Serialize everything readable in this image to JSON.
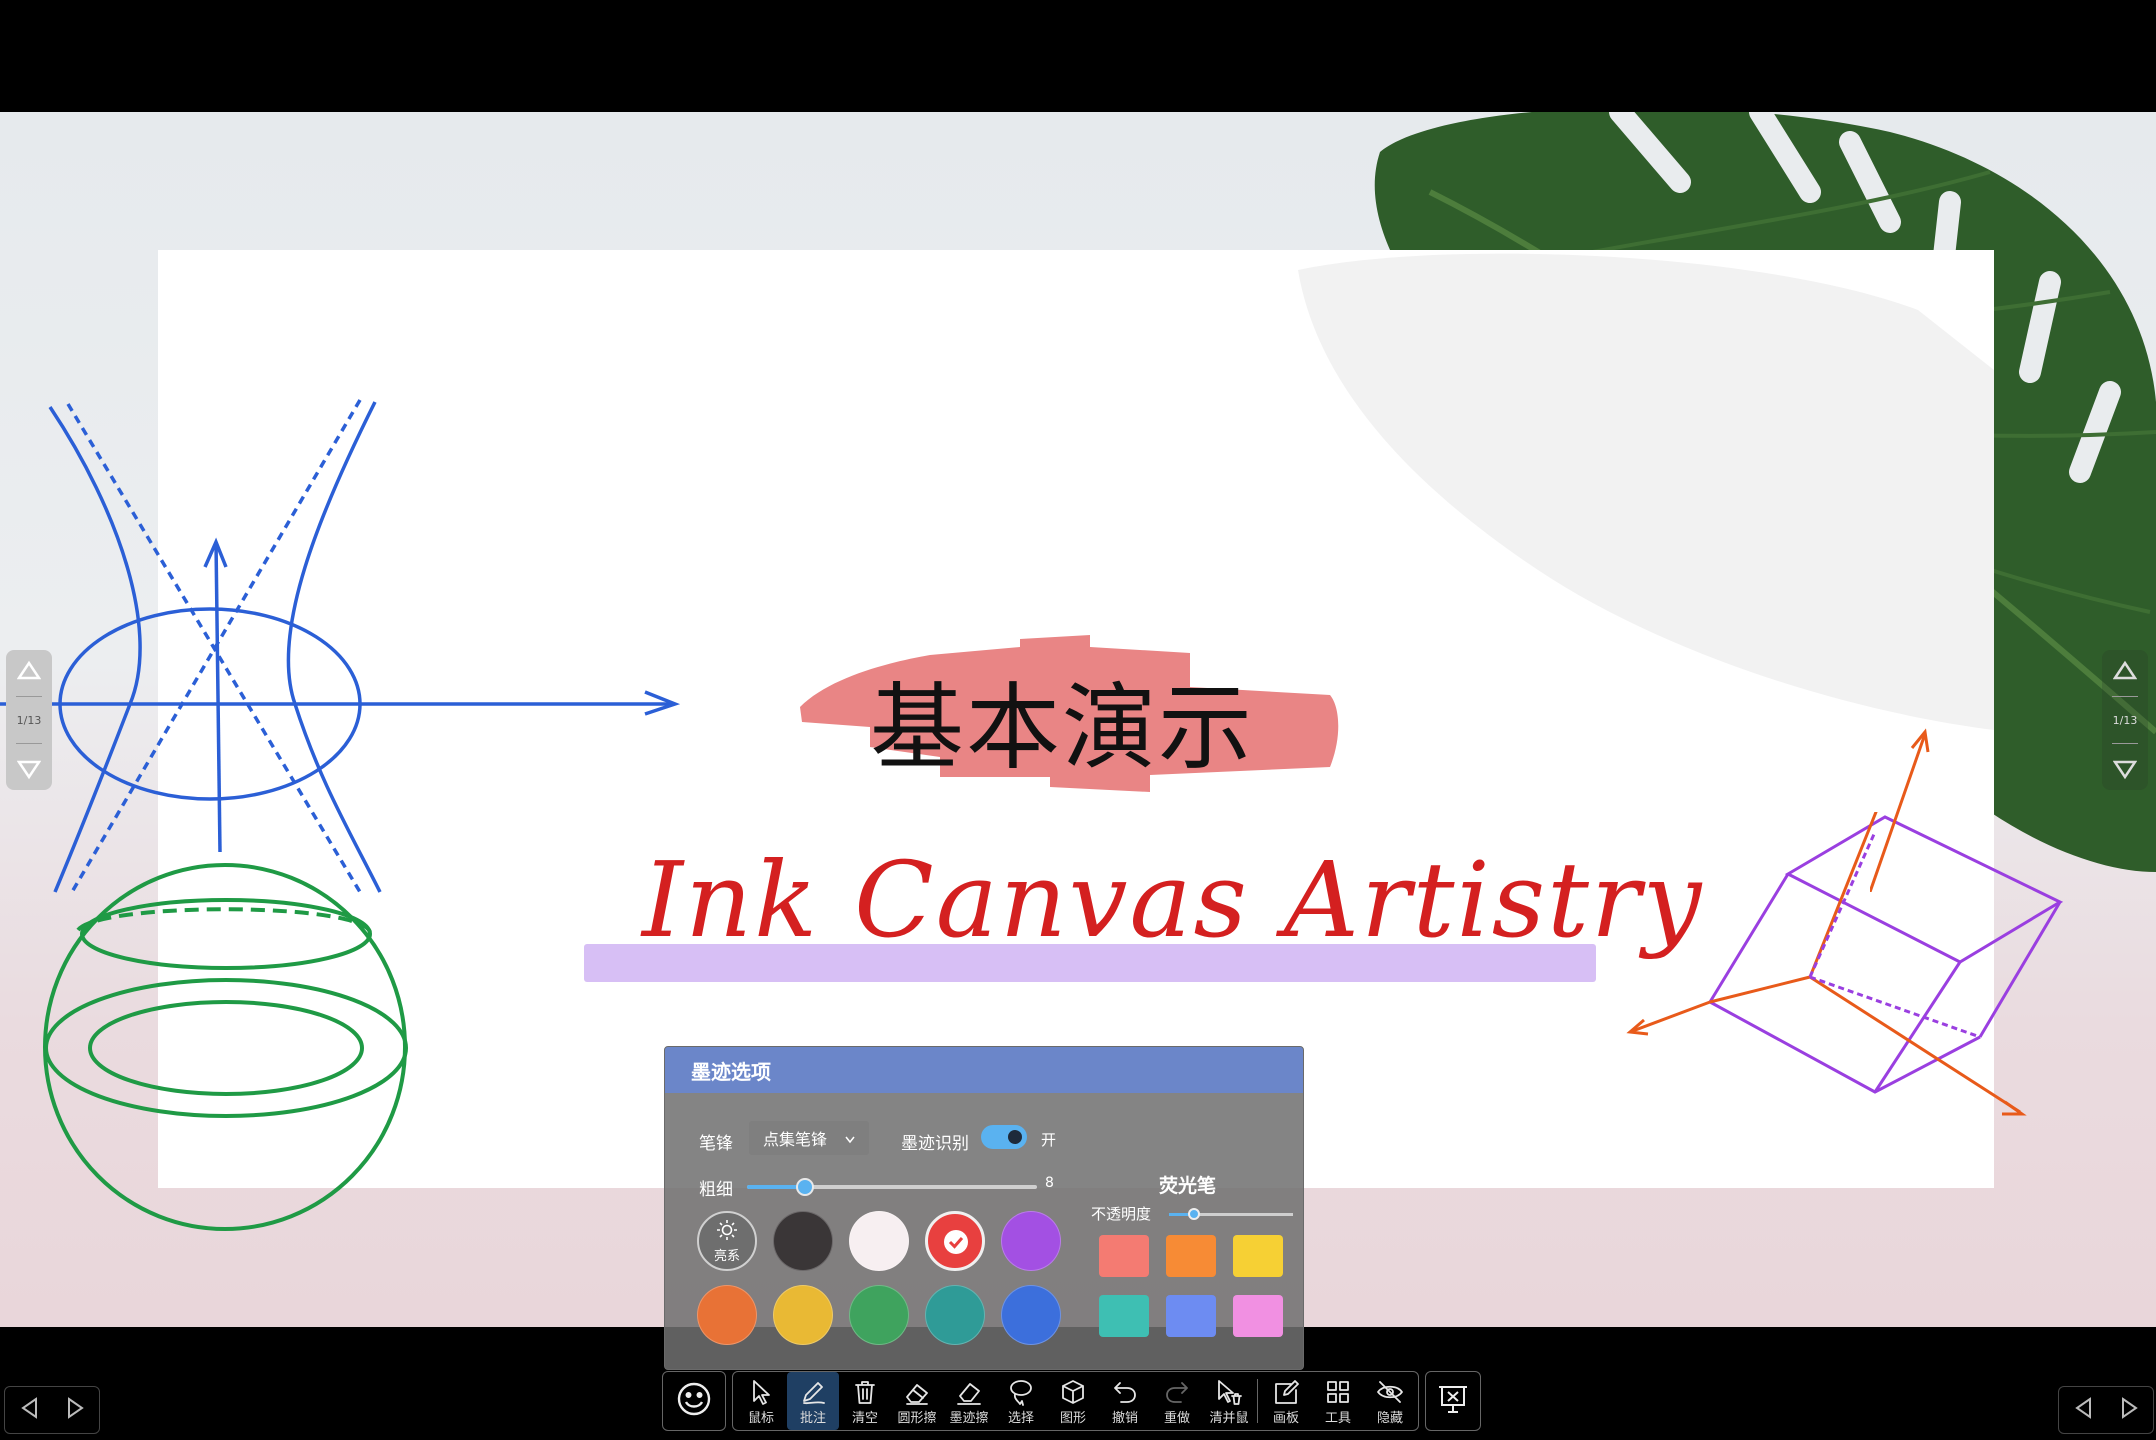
{
  "slide": {
    "title_cn": "基本演示",
    "subtitle": "Ink Canvas Artistry",
    "page_indicator": "1/13"
  },
  "ink_options": {
    "header": "墨迹选项",
    "pen_tip_label": "笔锋",
    "pen_tip_value": "点集笔锋",
    "ink_recognition_label": "墨迹识别",
    "ink_recognition_state": "开",
    "thickness_label": "粗细",
    "thickness_value": "8",
    "thickness_fraction": 0.2,
    "bright_label": "亮系",
    "highlighter_label": "荧光笔",
    "opacity_label": "不透明度",
    "opacity_fraction": 0.2,
    "pen_colors": [
      "#3a3637",
      "#f7eff1",
      "#e8403f",
      "#a350e3",
      "#e87236",
      "#e9b934",
      "#3fa35e",
      "#2f9b97",
      "#3c6fdc"
    ],
    "selected_pen_color": "#e8403f",
    "highlighter_colors": [
      "#f47b72",
      "#f78b35",
      "#f6d034",
      "#3ebfb3",
      "#6d8cf2",
      "#f190e2"
    ]
  },
  "toolbar": {
    "items": [
      {
        "id": "mouse",
        "label": "鼠标",
        "icon": "cursor-icon"
      },
      {
        "id": "annotate",
        "label": "批注",
        "icon": "pen-icon",
        "active": true
      },
      {
        "id": "clear",
        "label": "清空",
        "icon": "trash-icon"
      },
      {
        "id": "shape-erase",
        "label": "圆形擦",
        "icon": "eraser-icon"
      },
      {
        "id": "ink-erase",
        "label": "墨迹擦",
        "icon": "eraser-stroke-icon"
      },
      {
        "id": "select",
        "label": "选择",
        "icon": "lasso-icon"
      },
      {
        "id": "shape",
        "label": "图形",
        "icon": "cube-icon"
      },
      {
        "id": "undo",
        "label": "撤销",
        "icon": "undo-icon"
      },
      {
        "id": "redo",
        "label": "重做",
        "icon": "redo-icon"
      },
      {
        "id": "clear-mouse",
        "label": "清并鼠",
        "icon": "cursor-trash-icon"
      },
      {
        "id": "board",
        "label": "画板",
        "icon": "board-icon"
      },
      {
        "id": "tools",
        "label": "工具",
        "icon": "grid-icon"
      },
      {
        "id": "hide",
        "label": "隐藏",
        "icon": "eye-off-icon"
      }
    ],
    "emoji_icon": "smile-icon",
    "exit_icon": "exit-presentation-icon"
  },
  "colors": {
    "annotation_blue": "#2b5fd6",
    "annotation_green": "#1f9a45",
    "annotation_purple": "#9a3fe0",
    "annotation_orange": "#e85a1a",
    "title_highlight": "#e98585",
    "subtitle_red": "#d42020",
    "subtitle_highlight": "#d7bff5",
    "panel_header": "#6b86c9",
    "accent": "#5ab2f0"
  }
}
